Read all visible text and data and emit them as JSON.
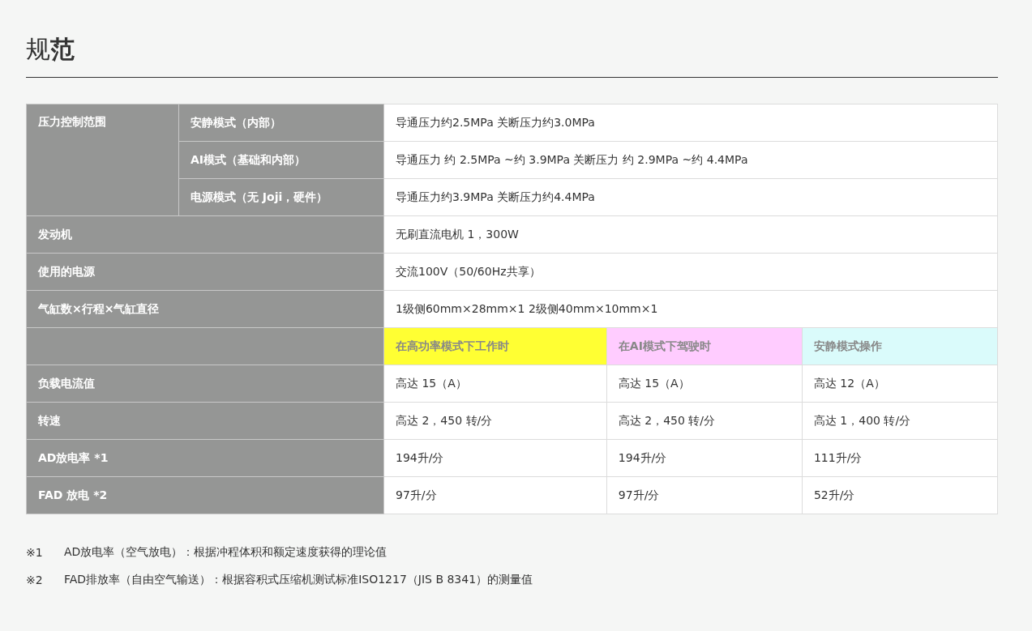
{
  "title": "规**范**",
  "pressure_control": {
    "label": "压力控制范围",
    "modes": [
      {
        "label": "安静模式（内部）",
        "value": "导通压力约2.5MPa 关断压力约3.0MPa"
      },
      {
        "label": "AI模式（基础和内部）",
        "value": "导通压力 约 2.5MPa ~约 3.9MPa 关断压力 约 2.9MPa ~约 4.4MPa"
      },
      {
        "label": "电源模式（无 Joji，硬件）",
        "value": "导通压力约3.9MPa 关断压力约4.4MPa"
      }
    ]
  },
  "spec_rows": [
    {
      "label": "发动机",
      "value": "无刷直流电机 1，300W"
    },
    {
      "label": "使用的电源",
      "value": "交流100V（50/60Hz共享）"
    },
    {
      "label": "气缸数×行程×气缸直径",
      "value": "1级侧60mm×28mm×1 2级侧40mm×10mm×1"
    }
  ],
  "mode_columns": [
    {
      "label": "在高功率模式下工作时",
      "color": "#ffff33"
    },
    {
      "label": "在AI模式下驾驶时",
      "color": "#ffccff"
    },
    {
      "label": "安静模式操作",
      "color": "#dafbfb"
    }
  ],
  "performance_rows": [
    {
      "label": "负载电流值",
      "values": [
        "高达 15（A）",
        "高达 15（A）",
        "高达 12（A）"
      ]
    },
    {
      "label": "转速",
      "values": [
        "高达 2，450 转/分",
        "高达 2，450 转/分",
        "高达 1，400 转/分"
      ]
    },
    {
      "label": "AD放电率 *1",
      "values": [
        "194升/分",
        "194升/分",
        "111升/分"
      ]
    },
    {
      "label": "FAD 放电 *2",
      "values": [
        "97升/分",
        "97升/分",
        "52升/分"
      ]
    }
  ],
  "footnotes": [
    {
      "mark": "※1",
      "text": "AD放电率（空气放电）：根据冲程体积和额定速度获得的理论值"
    },
    {
      "mark": "※2",
      "text": "FAD排放率（自由空气输送）：根据容积式压缩机测试标准ISO1217（JIS B 8341）的测量值"
    }
  ]
}
